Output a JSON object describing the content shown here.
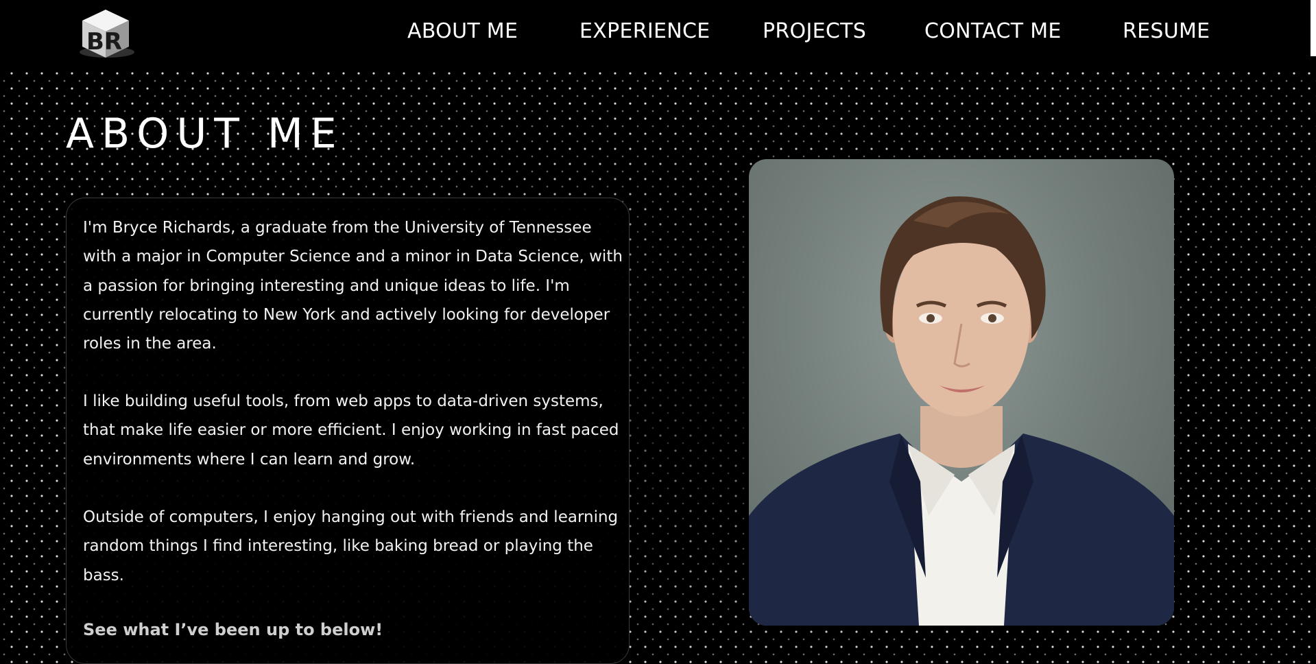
{
  "logo": {
    "text": "BR",
    "icon": "br-cube-logo-icon"
  },
  "nav": {
    "about": "ABOUT ME",
    "experience": "EXPERIENCE",
    "projects": "PROJECTS",
    "contact": "CONTACT ME",
    "resume": "RESUME"
  },
  "about": {
    "title": "ABOUT ME",
    "paragraphs": [
      "I'm Bryce Richards, a graduate from the University of Tennessee with a major in Computer Science and a minor in Data Science, with a passion for bringing interesting and unique ideas to life. I'm currently relocating to New York and actively looking for developer roles in the area.",
      "I like building useful tools, from web apps to data-driven systems, that make life easier or more efficient. I enjoy working in fast paced environments where I can learn and grow.",
      "Outside of computers, I enjoy hanging out with friends and learning random things I find interesting, like baking bread or playing the bass."
    ],
    "cta": "See what I’ve been up to below!"
  },
  "colors": {
    "background": "#000000",
    "text": "#ffffff",
    "card_border": "#3a3a3a",
    "cta": "#cfcfcf"
  }
}
